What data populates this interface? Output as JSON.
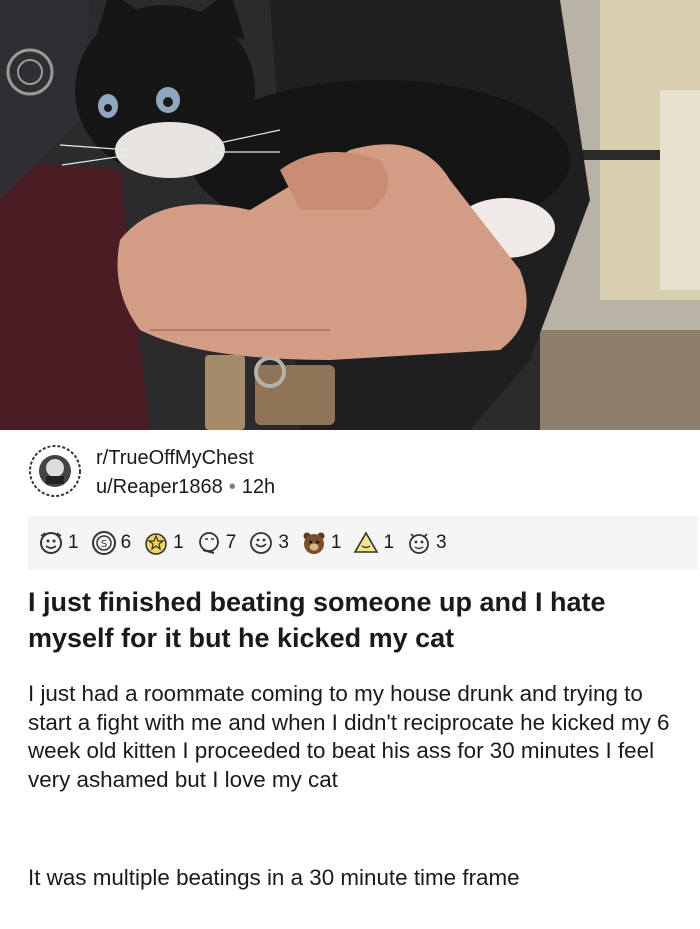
{
  "post": {
    "subreddit": "r/TrueOffMyChest",
    "username": "u/Reaper1868",
    "separator": "•",
    "age": "12h",
    "title": "I just finished beating someone up and I hate myself for it but he kicked my cat",
    "body_paragraph_1": "I just had a roommate coming to my house drunk and trying to start a fight with me and when I didn't reciprocate he kicked my 6 week old kitten I proceeded to beat his ass for 30 minutes I feel very ashamed but I love my cat",
    "body_paragraph_2": "It was multiple beatings in a 30 minute time frame"
  },
  "awards": [
    {
      "icon": "hugz-award-icon",
      "count": "1"
    },
    {
      "icon": "silver-coin-award-icon",
      "count": "6"
    },
    {
      "icon": "wholesome-award-icon",
      "count": "1"
    },
    {
      "icon": "thinking-award-icon",
      "count": "7"
    },
    {
      "icon": "helpful-award-icon",
      "count": "3"
    },
    {
      "icon": "bear-award-icon",
      "count": "1"
    },
    {
      "icon": "triangle-award-icon",
      "count": "1"
    },
    {
      "icon": "hugs-award-icon",
      "count": "3"
    }
  ],
  "colors": {
    "text": "#1a1a1b",
    "muted": "#7c7c7c",
    "award_bar_bg": "#f5f5f5"
  }
}
